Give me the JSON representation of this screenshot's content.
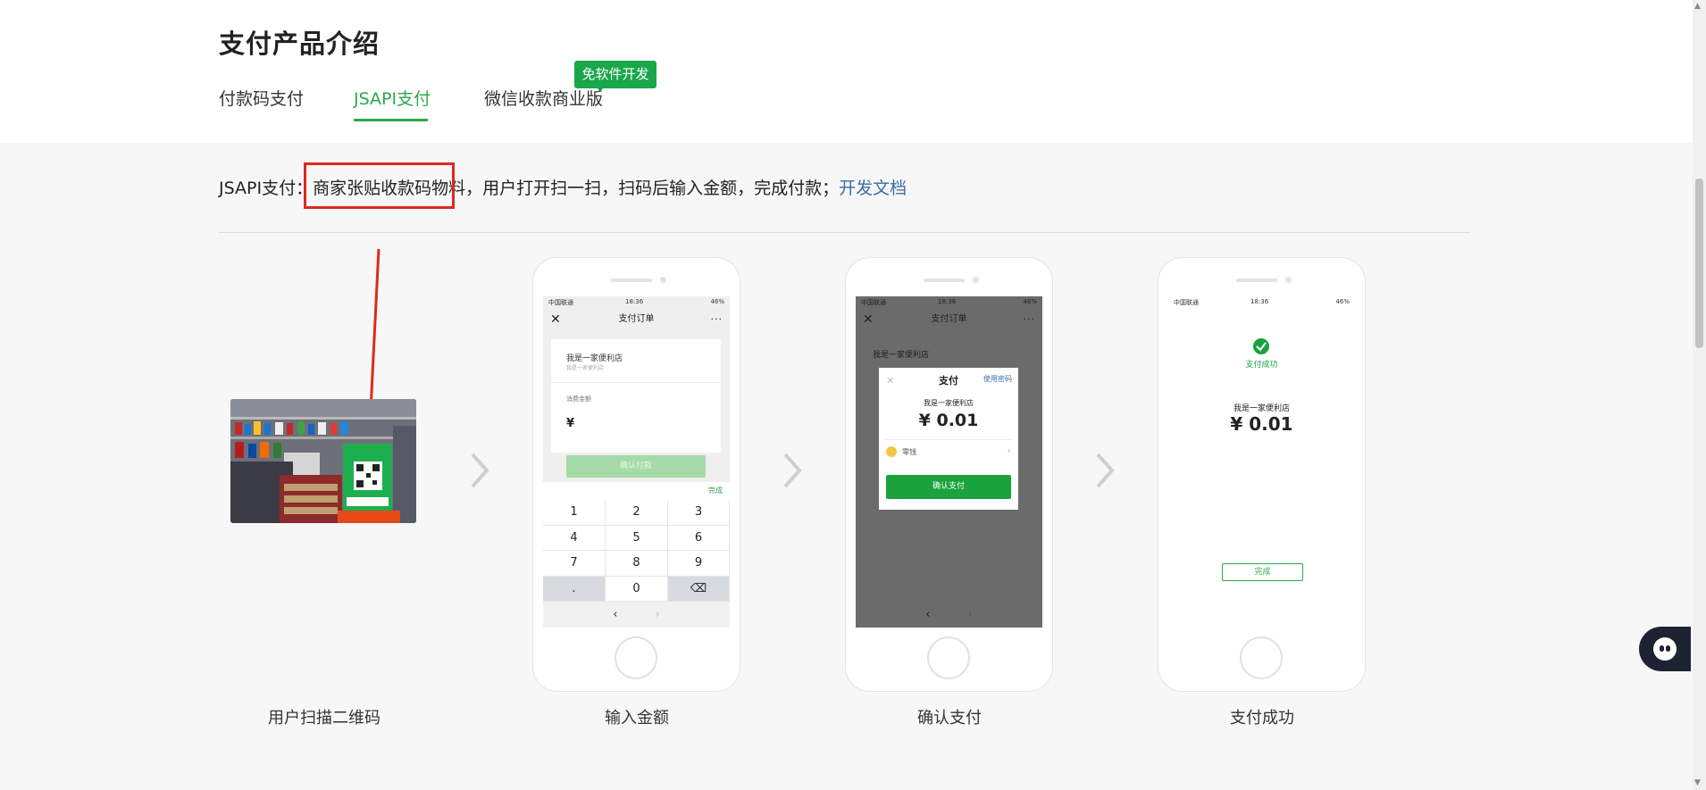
{
  "page": {
    "title": "支付产品介绍"
  },
  "tabs": [
    {
      "label": "付款码支付",
      "active": false
    },
    {
      "label": "JSAPI支付",
      "active": true
    },
    {
      "label": "微信收款商业版",
      "active": false
    }
  ],
  "badge": {
    "label": "免软件开发"
  },
  "description": {
    "prefix": "JSAPI支付：",
    "highlight": "商家张贴收款码物料",
    "middle": "，用户打开扫一扫，扫码后输入金额，完成付款；",
    "link": "开发文档"
  },
  "steps": [
    {
      "label": "用户扫描二维码"
    },
    {
      "label": "输入金额"
    },
    {
      "label": "确认支付"
    },
    {
      "label": "支付成功"
    }
  ],
  "phone_common": {
    "carrier": "中国联通",
    "time": "18:36",
    "battery": "46%"
  },
  "phone_input": {
    "nav_title": "支付订单",
    "merchant": "我是一家便利店",
    "merchant_sub": "我是一家便利店",
    "amount_label": "消费金额",
    "currency": "¥",
    "confirm": "确认付款",
    "done": "完成",
    "keys": [
      "1",
      "2",
      "3",
      "4",
      "5",
      "6",
      "7",
      "8",
      "9",
      ".",
      "0",
      "⌫"
    ],
    "back": "‹",
    "forward": "›"
  },
  "phone_confirm": {
    "nav_title": "支付订单",
    "merchant_bg": "我是一家便利店",
    "modal_title": "支付",
    "modal_password": "使用密码",
    "modal_close": "✕",
    "modal_merchant": "我是一家便利店",
    "modal_amount": "¥ 0.01",
    "method": "零钱",
    "confirm": "确认支付",
    "back": "‹",
    "forward": "›"
  },
  "phone_success": {
    "status": "支付成功",
    "merchant": "我是一家便利店",
    "amount": "¥ 0.01",
    "done": "完成"
  },
  "colors": {
    "brand_green": "#2ba84a",
    "badge_green": "#19a74a",
    "highlight_red": "#e0281f",
    "link_blue": "#3a6ea5"
  }
}
